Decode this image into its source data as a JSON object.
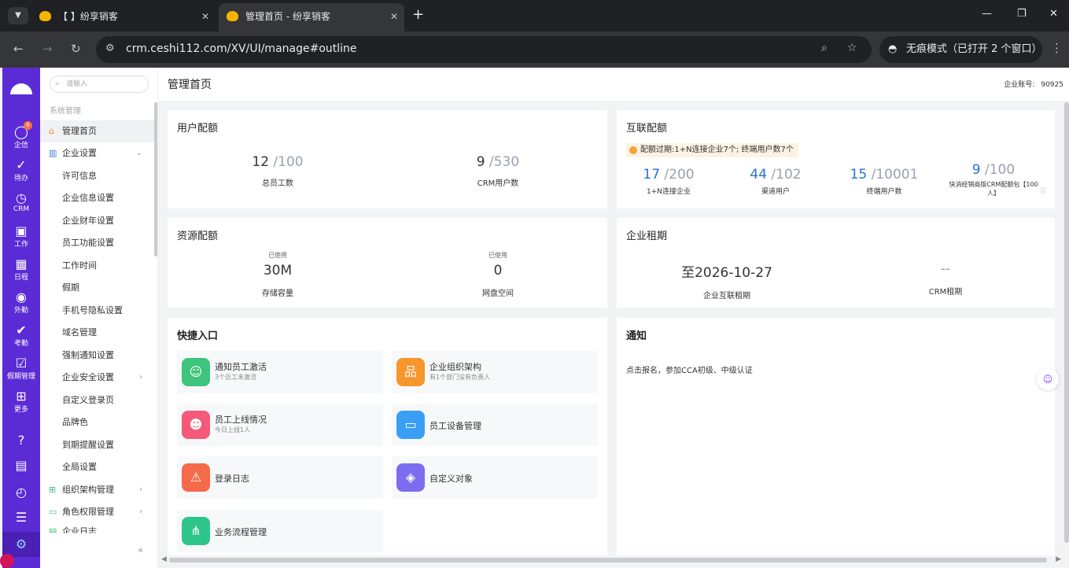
{
  "browser": {
    "tabs": [
      {
        "title": "【          】纷享销客",
        "active": false
      },
      {
        "title": "管理首页 - 纷享销客",
        "active": true
      }
    ],
    "new_tab": "+",
    "url": "crm.ceshi112.com/XV/UI/manage#outline",
    "incognito": "无痕模式（已打开 2 个窗口）"
  },
  "rail": {
    "badge": "6",
    "items": [
      "企信",
      "待办",
      "CRM",
      "工作",
      "日程",
      "外勤",
      "考勤",
      "假期管理",
      "更多"
    ]
  },
  "sidebar": {
    "search_placeholder": "请输入",
    "group_title": "系统管理",
    "items": [
      {
        "label": "管理首页",
        "active": true
      },
      {
        "label": "企业设置"
      },
      {
        "label": "许可信息"
      },
      {
        "label": "企业信息设置"
      },
      {
        "label": "企业财年设置"
      },
      {
        "label": "员工功能设置"
      },
      {
        "label": "工作时间"
      },
      {
        "label": "假期"
      },
      {
        "label": "手机号隐私设置"
      },
      {
        "label": "域名管理"
      },
      {
        "label": "强制通知设置"
      },
      {
        "label": "企业安全设置"
      },
      {
        "label": "自定义登录页"
      },
      {
        "label": "品牌色"
      },
      {
        "label": "到期提醒设置"
      },
      {
        "label": "全局设置"
      },
      {
        "label": "组织架构管理"
      },
      {
        "label": "角色权限管理"
      },
      {
        "label": "企业日志"
      }
    ]
  },
  "header": {
    "title": "管理首页",
    "account_label": "企业账号:",
    "account_value": "90925"
  },
  "user_quota": {
    "title": "用户配额",
    "metrics": [
      {
        "value": "12",
        "total": "/100",
        "label": "总员工数"
      },
      {
        "value": "9",
        "total": "/530",
        "label": "CRM用户数"
      }
    ]
  },
  "interconnect_quota": {
    "title": "互联配额",
    "alert": "配额过期:1+N连接企业7个; 终端用户数7个",
    "metrics": [
      {
        "value": "17",
        "total": "/200",
        "label": "1+N连接企业"
      },
      {
        "value": "44",
        "total": "/102",
        "label": "渠道用户"
      },
      {
        "value": "15",
        "total": "/10001",
        "label": "终端用户数"
      },
      {
        "value": "9",
        "total": "/100",
        "label": "快消经销商版CRM配额包【100人】"
      }
    ]
  },
  "resource_quota": {
    "title": "资源配额",
    "metrics": [
      {
        "caption": "已使用",
        "value": "30M",
        "label": "存储容量"
      },
      {
        "caption": "已使用",
        "value": "0",
        "label": "网盘空间"
      }
    ]
  },
  "lease": {
    "title": "企业租期",
    "metrics": [
      {
        "value": "至2026-10-27",
        "label": "企业互联租期"
      },
      {
        "value": "--",
        "label": "CRM租期"
      }
    ]
  },
  "shortcuts": {
    "title": "快捷入口",
    "items": [
      {
        "title": "通知员工激活",
        "sub": "3个员工未激活",
        "color": "#3ec47c"
      },
      {
        "title": "企业组织架构",
        "sub": "有1个部门没有负责人",
        "color": "#f6962b"
      },
      {
        "title": "员工上线情况",
        "sub": "今日上线1人",
        "color": "#f45a7a"
      },
      {
        "title": "员工设备管理",
        "sub": "",
        "color": "#3a9ef5"
      },
      {
        "title": "登录日志",
        "sub": "",
        "color": "#f56a4a"
      },
      {
        "title": "自定义对象",
        "sub": "",
        "color": "#7c6cf0"
      },
      {
        "title": "业务流程管理",
        "sub": "",
        "color": "#2ec58a"
      }
    ]
  },
  "notice": {
    "title": "通知",
    "text": "点击报名，参加CCA初级、中级认证"
  }
}
